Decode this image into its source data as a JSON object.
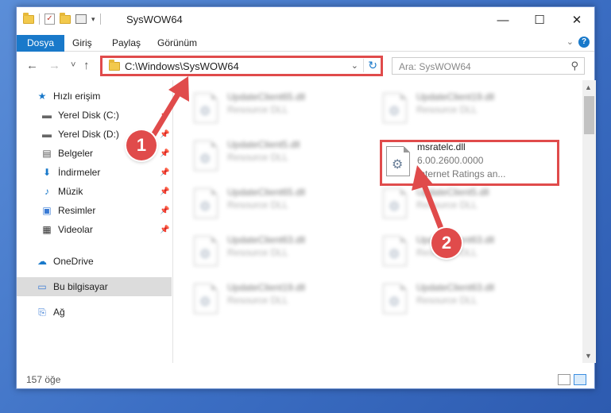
{
  "window": {
    "title": "SysWOW64",
    "controls": {
      "minimize": "—",
      "maximize": "☐",
      "close": "✕"
    }
  },
  "ribbon": {
    "tabs": [
      "Dosya",
      "Giriş",
      "Paylaş",
      "Görünüm"
    ],
    "help": "?"
  },
  "navigation": {
    "back": "←",
    "forward": "→",
    "recent": "˅",
    "up": "↑",
    "address": "C:\\Windows\\SysWOW64",
    "search_placeholder": "Ara: SysWOW64"
  },
  "nav_pane": {
    "quick_access": "Hızlı erişim",
    "items": [
      {
        "label": "Yerel Disk (C:)",
        "icon": "drive-icon",
        "pinned": true
      },
      {
        "label": "Yerel Disk (D:)",
        "icon": "drive-icon",
        "pinned": true
      },
      {
        "label": "Belgeler",
        "icon": "documents-icon",
        "pinned": true
      },
      {
        "label": "İndirmeler",
        "icon": "download-icon",
        "pinned": true
      },
      {
        "label": "Müzik",
        "icon": "music-icon",
        "pinned": true
      },
      {
        "label": "Resimler",
        "icon": "pictures-icon",
        "pinned": true
      },
      {
        "label": "Videolar",
        "icon": "videos-icon",
        "pinned": true
      }
    ],
    "onedrive": "OneDrive",
    "this_pc": "Bu bilgisayar",
    "network": "Ağ"
  },
  "files": [
    {
      "name": "UpdateClient65.dll",
      "sub": "Resource DLL",
      "blurred": true
    },
    {
      "name": "UpdateClient19.dll",
      "sub": "Resource DLL",
      "blurred": true
    },
    {
      "name": "UpdateClient5.dll",
      "sub": "Resource DLL",
      "blurred": true
    },
    {
      "name": "msratelc.dll",
      "sub": "6.00.2600.0000",
      "sub2": "Internet Ratings an...",
      "blurred": false
    },
    {
      "name": "UpdateClient65.dll",
      "sub": "Resource DLL",
      "blurred": true
    },
    {
      "name": "UpdateClient5.dll",
      "sub": "Resource DLL",
      "blurred": true
    },
    {
      "name": "UpdateClient63.dll",
      "sub": "Resource DLL",
      "blurred": true
    },
    {
      "name": "UpdateClient63.dll",
      "sub": "Resource DLL",
      "blurred": true
    },
    {
      "name": "UpdateClient19.dll",
      "sub": "Resource DLL",
      "blurred": true
    },
    {
      "name": "UpdateClient63.dll",
      "sub": "Resource DLL",
      "blurred": true
    }
  ],
  "status": {
    "item_count": "157 öğe"
  },
  "annotations": {
    "step1": "1",
    "step2": "2",
    "color": "#e04b4b"
  }
}
